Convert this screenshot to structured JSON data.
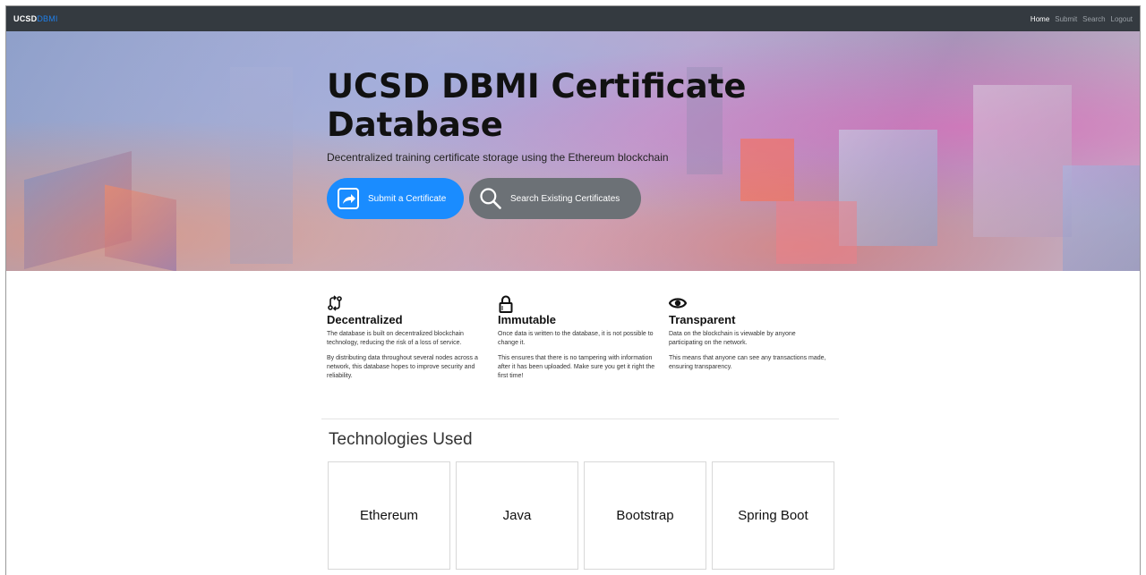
{
  "navbar": {
    "brand_main": "UCSD",
    "brand_accent": "DBMI",
    "links": [
      {
        "label": "Home",
        "active": true
      },
      {
        "label": "Submit",
        "active": false
      },
      {
        "label": "Search",
        "active": false
      },
      {
        "label": "Logout",
        "active": false
      }
    ]
  },
  "hero": {
    "title_line1": "UCSD DBMI Certificate",
    "title_line2": "Database",
    "subtitle": "Decentralized training certificate storage using the Ethereum blockchain",
    "submit_button": {
      "label": "Submit a Certificate",
      "icon": "share-arrow-icon"
    },
    "search_button": {
      "label": "Search Existing Certificates",
      "icon": "search-icon"
    }
  },
  "features": [
    {
      "icon": "git-compare-icon",
      "title": "Decentralized",
      "paragraphs": [
        "The database is built on decentralized blockchain technology, reducing the risk of a loss of service.",
        "By distributing data throughout several nodes across a network, this database hopes to improve security and reliability."
      ]
    },
    {
      "icon": "lock-icon",
      "title": "Immutable",
      "paragraphs": [
        "Once data is written to the database, it is not possible to change it.",
        "This ensures that there is no tampering with information after it has been uploaded. Make sure you get it right the first time!"
      ]
    },
    {
      "icon": "eye-icon",
      "title": "Transparent",
      "paragraphs": [
        "Data on the blockchain is viewable by anyone participating on the network.",
        "This means that anyone can see any transactions made, ensuring transparency."
      ]
    }
  ],
  "technologies": {
    "heading": "Technologies Used",
    "items": [
      "Ethereum",
      "Java",
      "Bootstrap",
      "Spring Boot"
    ]
  },
  "colors": {
    "navbar_bg": "#343a40",
    "brand_accent": "#1f7fe8",
    "primary_button": "#1a8cff",
    "secondary_button": "#6c7176"
  }
}
